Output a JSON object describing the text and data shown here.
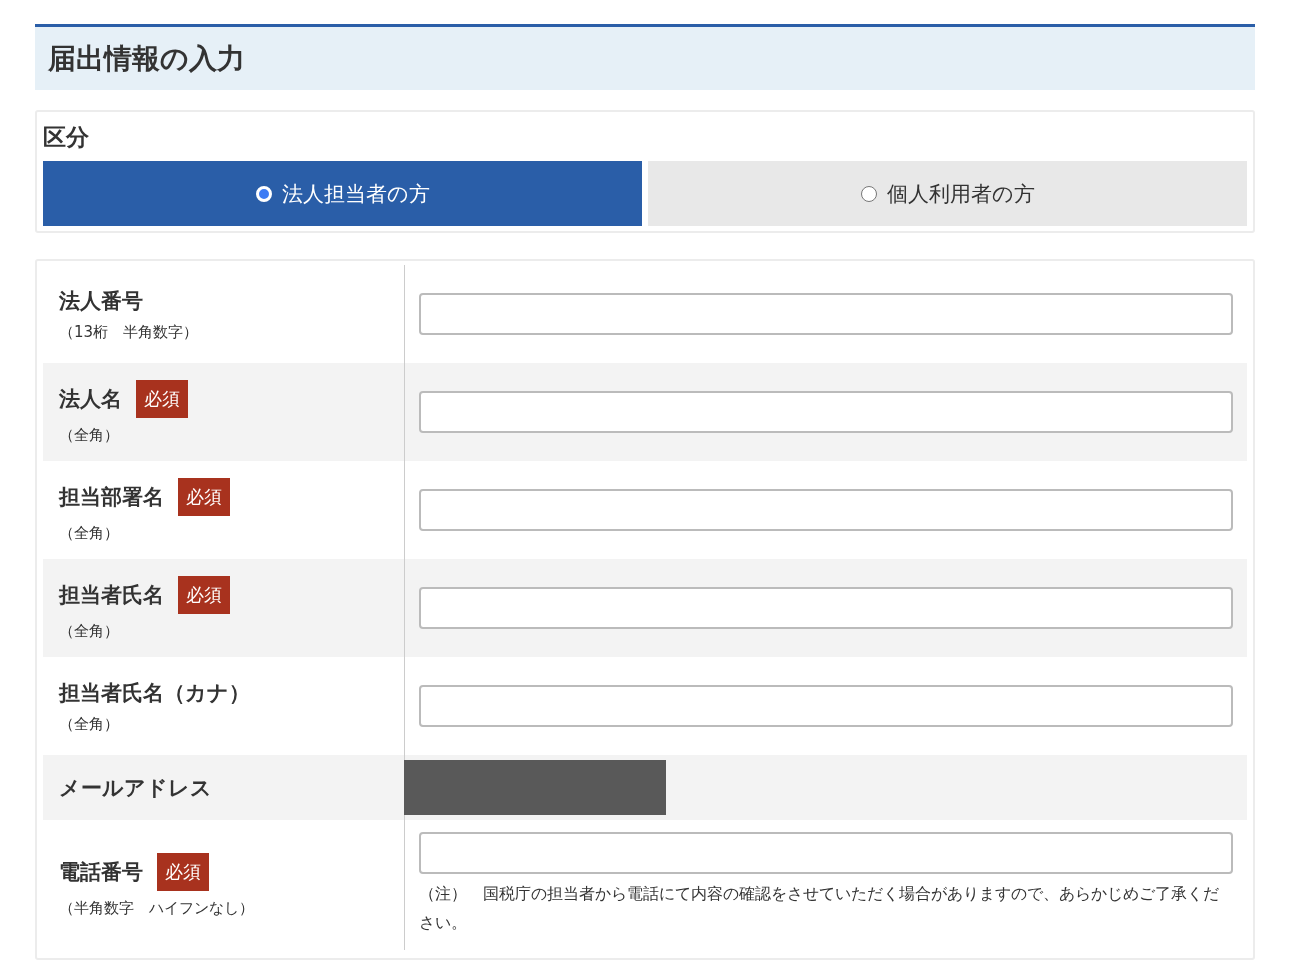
{
  "heading": "届出情報の入力",
  "category": {
    "label": "区分",
    "options": [
      {
        "label": "法人担当者の方",
        "selected": true
      },
      {
        "label": "個人利用者の方",
        "selected": false
      }
    ]
  },
  "fields": [
    {
      "kind": "input",
      "label": "法人番号",
      "hint": "（13桁　半角数字）"
    },
    {
      "kind": "input",
      "label": "法人名",
      "badge": "必須",
      "hint": "（全角）"
    },
    {
      "kind": "input",
      "label": "担当部署名",
      "badge": "必須",
      "hint": "（全角）"
    },
    {
      "kind": "input",
      "label": "担当者氏名",
      "badge": "必須",
      "hint": "（全角）"
    },
    {
      "kind": "input",
      "label": "担当者氏名（カナ）",
      "hint": "（全角）"
    },
    {
      "kind": "redacted",
      "label": "メールアドレス"
    },
    {
      "kind": "input",
      "label": "電話番号",
      "badge": "必須",
      "hint": "（半角数字　ハイフンなし）",
      "note": "（注）　国税庁の担当者から電話にて内容の確認をさせていただく場合がありますので、あらかじめご了承ください。"
    }
  ]
}
